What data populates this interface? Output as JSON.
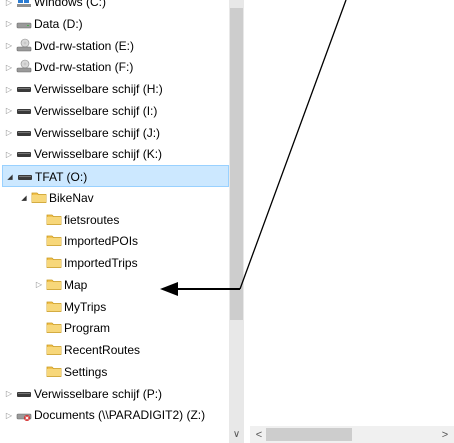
{
  "tree": {
    "items": [
      {
        "label": "Windows (C:)",
        "icon": "windows-drive-icon",
        "expand": "collapsed"
      },
      {
        "label": "Data (D:)",
        "icon": "hard-drive-icon",
        "expand": "collapsed"
      },
      {
        "label": "Dvd-rw-station (E:)",
        "icon": "dvd-drive-icon",
        "expand": "collapsed"
      },
      {
        "label": "Dvd-rw-station (F:)",
        "icon": "dvd-drive-icon",
        "expand": "collapsed"
      },
      {
        "label": "Verwisselbare schijf (H:)",
        "icon": "removable-drive-icon",
        "expand": "collapsed"
      },
      {
        "label": "Verwisselbare schijf (I:)",
        "icon": "removable-drive-icon",
        "expand": "collapsed"
      },
      {
        "label": "Verwisselbare schijf (J:)",
        "icon": "removable-drive-icon",
        "expand": "collapsed"
      },
      {
        "label": "Verwisselbare schijf (K:)",
        "icon": "removable-drive-icon",
        "expand": "collapsed"
      },
      {
        "label": "TFAT (O:)",
        "icon": "removable-drive-icon",
        "expand": "expanded",
        "selected": true
      },
      {
        "label": "BikeNav",
        "icon": "folder-icon",
        "expand": "expanded"
      },
      {
        "label": "fietsroutes",
        "icon": "folder-icon",
        "expand": "none"
      },
      {
        "label": "ImportedPOIs",
        "icon": "folder-icon",
        "expand": "none"
      },
      {
        "label": "ImportedTrips",
        "icon": "folder-icon",
        "expand": "none"
      },
      {
        "label": "Map",
        "icon": "folder-icon",
        "expand": "collapsed"
      },
      {
        "label": "MyTrips",
        "icon": "folder-icon",
        "expand": "none"
      },
      {
        "label": "Program",
        "icon": "folder-icon",
        "expand": "none"
      },
      {
        "label": "RecentRoutes",
        "icon": "folder-icon",
        "expand": "none"
      },
      {
        "label": "Settings",
        "icon": "folder-icon",
        "expand": "none"
      },
      {
        "label": "Verwisselbare schijf (P:)",
        "icon": "removable-drive-icon",
        "expand": "collapsed"
      },
      {
        "label": "Documents (\\\\PARADIGIT2) (Z:)",
        "icon": "network-drive-icon",
        "expand": "collapsed"
      }
    ]
  },
  "scrollbars": {
    "down_glyph": "∨",
    "left_glyph": "<",
    "right_glyph": ">"
  },
  "glyphs": {
    "collapsed": "▷",
    "expanded": "◢"
  },
  "colors": {
    "selection_bg": "#cce8ff",
    "selection_border": "#99d1ff",
    "folder": "#f2c14e",
    "annotation": "#000000"
  }
}
